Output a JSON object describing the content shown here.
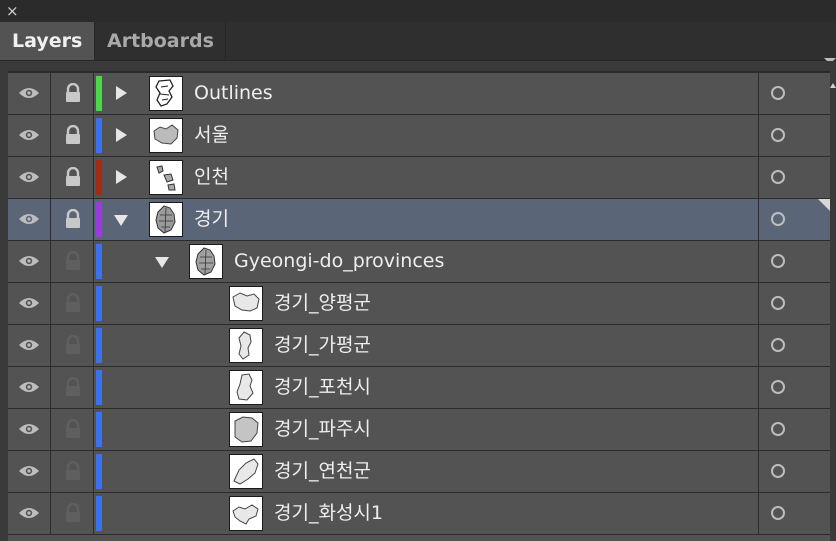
{
  "window": {
    "close_glyph": "×"
  },
  "tabs": [
    {
      "label": "Layers",
      "active": true
    },
    {
      "label": "Artboards",
      "active": false
    }
  ],
  "icons": {
    "visibility": "eye-icon",
    "lock": "lock-icon",
    "expand": "disclosure-triangle-icon",
    "target": "target-circle-icon",
    "panel_menu": "panel-menu-icon"
  },
  "colors": {
    "outlines": "#4ad94a",
    "seoul": "#3c72ee",
    "incheon": "#a52b18",
    "gyeonggi": "#9a3be0",
    "sublayer": "#3c72ee",
    "selected_row": "#5a6577"
  },
  "layers": [
    {
      "name": "Outlines",
      "expanded": false,
      "lock_visible": true,
      "thumb": "outlines"
    },
    {
      "name": "서울",
      "expanded": false,
      "lock_visible": true,
      "thumb": "seoul"
    },
    {
      "name": "인천",
      "expanded": false,
      "lock_visible": true,
      "thumb": "incheon"
    },
    {
      "name": "경기",
      "expanded": true,
      "selected": true,
      "lock_visible": true,
      "thumb": "gyeonggi"
    },
    {
      "name": "Gyeongi-do_provinces",
      "expanded": true,
      "thumb": "provinces"
    },
    {
      "name": "경기_양평군",
      "thumb": "yangpyeong"
    },
    {
      "name": "경기_가평군",
      "thumb": "gapyeong"
    },
    {
      "name": "경기_포천시",
      "thumb": "pocheon"
    },
    {
      "name": "경기_파주시",
      "thumb": "paju"
    },
    {
      "name": "경기_연천군",
      "thumb": "yeoncheon"
    },
    {
      "name": "경기_화성시1",
      "thumb": "hwaseong"
    }
  ]
}
